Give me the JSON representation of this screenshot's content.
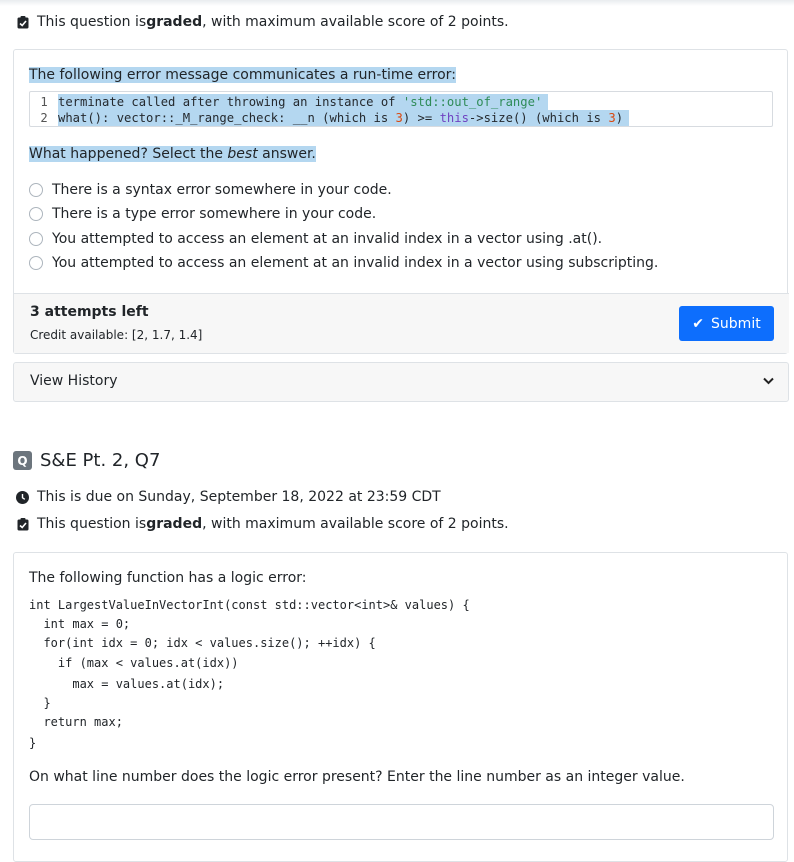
{
  "q1": {
    "graded_prefix": "This question is ",
    "graded_bold": "graded",
    "graded_suffix": ", with maximum available score of 2 points.",
    "prompt": "The following error message communicates a run-time error:",
    "code": [
      {
        "num": "1",
        "text_a": "terminate called after throwing an instance of ",
        "text_str": "'std::out_of_range'"
      },
      {
        "num": "2",
        "text_a": "what(): vector::_M_range_check: __n (which is ",
        "text_n1": "3",
        "text_b": ") >= ",
        "text_kw": "this",
        "text_c": "->size() (which is ",
        "text_n2": "3",
        "text_d": ")"
      }
    ],
    "question_a": "What happened? Select the ",
    "question_em": "best",
    "question_b": " answer.",
    "options": [
      "There is a syntax error somewhere in your code.",
      "There is a type error somewhere in your code.",
      "You attempted to access an element at an invalid index in a vector using .at().",
      "You attempted to access an element at an invalid index in a vector using subscripting."
    ],
    "attempts": "3 attempts left",
    "credit": "Credit available: [2, 1.7, 1.4]",
    "submit_label": "Submit",
    "history_label": "View History"
  },
  "q2": {
    "badge": "Q",
    "title": "S&E Pt. 2, Q7",
    "due": "This is due on Sunday, September 18, 2022 at 23:59 CDT",
    "graded_prefix": "This question is ",
    "graded_bold": "graded",
    "graded_suffix": ", with maximum available score of 2 points.",
    "prompt": "The following function has a logic error:",
    "code_lines": [
      "int LargestValueInVectorInt(const std::vector<int>& values) {",
      "  int max = 0;",
      "  for(int idx = 0; idx < values.size(); ++idx) {",
      "    if (max < values.at(idx))",
      "      max = values.at(idx);",
      "  }",
      "  return max;",
      "}"
    ],
    "question": "On what line number does the logic error present? Enter the line number as an integer value.",
    "input_value": ""
  },
  "colors": {
    "accent": "#0d6efd",
    "highlight": "#b4d7f0",
    "badge": "#6c757d"
  }
}
